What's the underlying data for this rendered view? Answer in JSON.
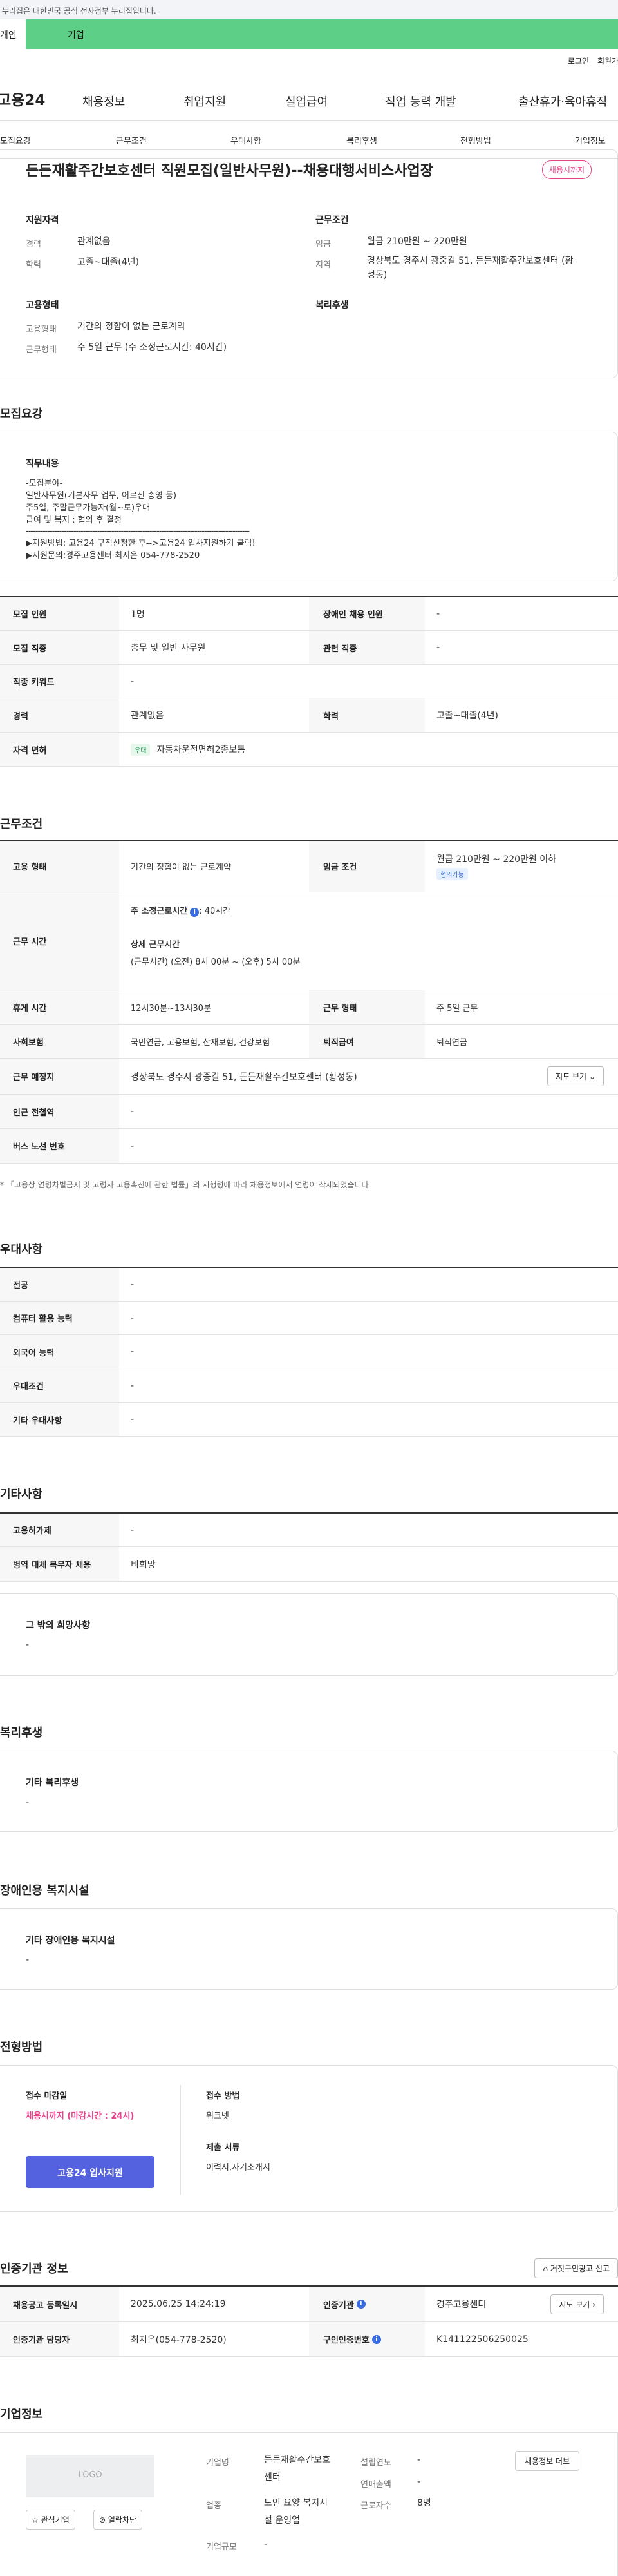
{
  "gov_banner": "이 누리집은 대한민국 공식 전자정부 누리집입니다.",
  "green_tabs": [
    "개인",
    "기업"
  ],
  "util_links": [
    "로그인",
    "회원가입"
  ],
  "logo": "고용24",
  "gnb": [
    "채용정보",
    "취업지원",
    "실업급여",
    "직업 능력 개발",
    "출산휴가·육아휴직"
  ],
  "anchor_tabs": [
    "모집요강",
    "근무조건",
    "우대사항",
    "복리후생",
    "전형방법",
    "기업정보"
  ],
  "title": "든든재활주간보호센터 직원모집(일반사무원)--채용대행서비스사업장",
  "badge": "채용시까지",
  "summary": {
    "qual_h": "지원자격",
    "career_l": "경력",
    "career_v": "관계없음",
    "edu_l": "학력",
    "edu_v": "고졸~대졸(4년)",
    "cond_h": "근무조건",
    "wage_l": "임금",
    "wage_v": "월급 210만원 ~ 220만원",
    "loc_l": "지역",
    "loc_v1": "경상북도 경주시 광중길 51, 든든재활주간보호센터 (황",
    "loc_v2": "성동)",
    "emp_h": "고용형태",
    "emptype_l": "고용형태",
    "emptype_v": "기간의 정함이 없는 근로계약",
    "worktype_l": "근무형태",
    "worktype_v": "주 5일 근무 (주 소정근로시간: 40시간)",
    "welfare_h": "복리후생"
  },
  "sec_recruit": "모집요강",
  "duty": {
    "h": "직무내용",
    "lines": [
      "-모집분야-",
      "일반사무원(기본사무 업무, 어르신 송영 등)",
      "주5일, 주말근무가능자(월~토)우대",
      "급여 및 복지 : 협의 후 결정",
      "----------------------------------------------------------------------------------------------",
      "▶지원방법: 고용24 구직신청한 후-->고용24 입사지원하기 클릭!",
      "▶지원문의:경주고용센터 최지은 054-778-2520"
    ]
  },
  "recruit_table": {
    "r1": [
      "모집 인원",
      "1명",
      "장애인 채용 인원",
      "-"
    ],
    "r2": [
      "모집 직종",
      "총무 및 일반 사무원",
      "관련 직종",
      "-"
    ],
    "r3": [
      "직종 키워드",
      "-"
    ],
    "r4": [
      "경력",
      "관계없음",
      "학력",
      "고졸~대졸(4년)"
    ],
    "r5_h": "자격 면허",
    "r5_chip": "우대",
    "r5_v": "자동차운전면허2종보통"
  },
  "sec_cond": "근무조건",
  "cond_table": {
    "emp_h": "고용 형태",
    "emp_v": "기간의 정함이 없는 근로계약",
    "wage_h": "임금 조건",
    "wage_v": "월급 210만원 ~ 220만원 이하",
    "wage_chip": "협의가능",
    "time_h": "근무 시간",
    "time_l1": "주 소정근로시간",
    "time_v1": ": 40시간",
    "time_l2": "상세 근무시간",
    "time_v2": "(근무시간) (오전) 8시 00분 ~ (오후) 5시 00분",
    "rest_h": "휴게 시간",
    "rest_v": "12시30분~13시30분",
    "form_h": "근무 형태",
    "form_v": "주 5일 근무",
    "ins_h": "사회보험",
    "ins_v": "국민연금, 고용보험, 산재보험, 건강보험",
    "ret_h": "퇴직급여",
    "ret_v": "퇴직연금",
    "place_h": "근무 예정지",
    "place_v": "경상북도 경주시 광중길 51, 든든재활주간보호센터 (황성동)",
    "map_btn": "지도 보기",
    "sub_h": "인근 전철역",
    "sub_v": "-",
    "bus_h": "버스 노선 번호",
    "bus_v": "-"
  },
  "cond_note": "* 「고용상 연령차별금지 및 고령자 고용촉진에 관한 법률」의 시행령에 따라 채용정보에서 연령이 삭제되었습니다.",
  "sec_pref": "우대사항",
  "pref": [
    [
      "전공",
      "-"
    ],
    [
      "컴퓨터 활용 능력",
      "-"
    ],
    [
      "외국어 능력",
      "-"
    ],
    [
      "우대조건",
      "-"
    ],
    [
      "기타 우대사항",
      "-"
    ]
  ],
  "sec_etc": "기타사항",
  "etc": [
    [
      "고용허가제",
      "-"
    ],
    [
      "병역 대체 복무자 채용",
      "비희망"
    ]
  ],
  "etc_box": {
    "h": "그 밖의 희망사항",
    "v": "-"
  },
  "sec_welfare": "복리후생",
  "welfare_box": {
    "h": "기타 복리후생",
    "v": "-"
  },
  "sec_disab": "장애인용 복지시설",
  "disab_box": {
    "h": "기타 장애인용 복지시설",
    "v": "-"
  },
  "sec_select": "전형방법",
  "select": {
    "deadline_h": "접수 마감일",
    "deadline_v": "채용시까지 (마감시간 : 24시)",
    "method_h": "접수 방법",
    "method_v": "워크넷",
    "docs_h": "제출 서류",
    "docs_v": "이력서,자기소개서",
    "apply": "고용24 입사지원"
  },
  "sec_agency": "인증기관 정보",
  "report_btn": "거짓구인광고 신고",
  "agency": {
    "reg_h": "채용공고 등록일시",
    "reg_v": "2025.06.25 14:24:19",
    "org_h": "인증기관",
    "org_v": "경주고용센터",
    "map_btn": "지도 보기",
    "mgr_h": "인증기관 담당자",
    "mgr_v": "최지은(054-778-2520)",
    "no_h": "구인인증번호",
    "no_v": "K141122506250025"
  },
  "sec_company": "기업정보",
  "company": {
    "logo": "LOGO",
    "fav": "관심기업",
    "block": "열람차단",
    "name_l": "기업명",
    "name_v1": "든든재활주간보호",
    "name_v2": "센터",
    "ind_l": "업종",
    "ind_v1": "노인 요양 복지시",
    "ind_v2": "설 운영업",
    "size_l": "기업규모",
    "size_v": "-",
    "year_l": "설립연도",
    "year_v": "-",
    "sales_l": "연매출액",
    "sales_v": "-",
    "emp_l": "근로자수",
    "emp_v": "8명",
    "more_btn": "채용정보 더보"
  }
}
